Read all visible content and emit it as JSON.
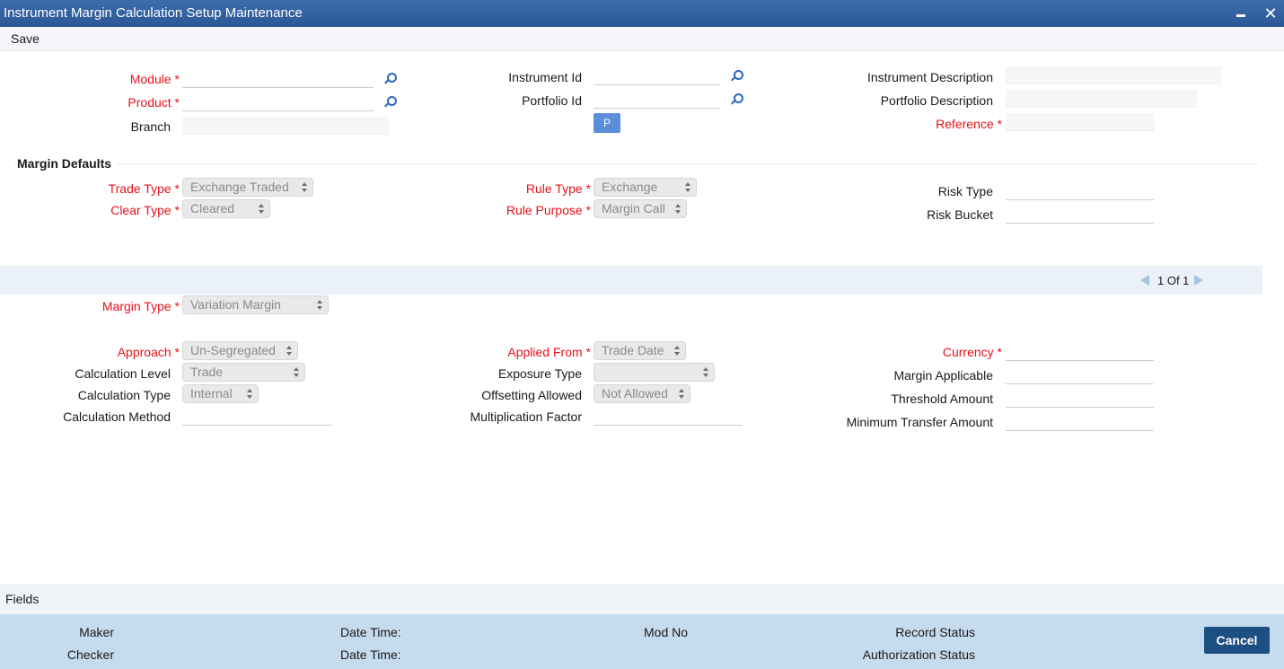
{
  "window": {
    "title": "Instrument Margin Calculation Setup Maintenance",
    "close_glyph": "✕"
  },
  "toolbar": {
    "save_label": "Save"
  },
  "header": {
    "module_label": "Module",
    "product_label": "Product",
    "branch_label": "Branch",
    "instrument_id_label": "Instrument Id",
    "portfolio_id_label": "Portfolio Id",
    "p_button_label": "P",
    "instrument_description_label": "Instrument Description",
    "portfolio_description_label": "Portfolio Description",
    "reference_label": "Reference",
    "module_value": "",
    "product_value": "",
    "branch_value": "",
    "instrument_id_value": "",
    "portfolio_id_value": "",
    "instrument_description_value": "",
    "portfolio_description_value": "",
    "reference_value": ""
  },
  "margin_defaults": {
    "section_title": "Margin Defaults",
    "trade_type": {
      "label": "Trade Type",
      "value": "Exchange Traded"
    },
    "clear_type": {
      "label": "Clear Type",
      "value": "Cleared"
    },
    "rule_type": {
      "label": "Rule Type",
      "value": "Exchange"
    },
    "rule_purpose": {
      "label": "Rule Purpose",
      "value": "Margin Call"
    },
    "risk_type": {
      "label": "Risk Type",
      "value": ""
    },
    "risk_bucket": {
      "label": "Risk Bucket",
      "value": ""
    }
  },
  "pager": {
    "text": "1 Of  1"
  },
  "margin_detail": {
    "margin_type": {
      "label": "Margin Type",
      "value": "Variation Margin"
    },
    "approach": {
      "label": "Approach",
      "value": "Un-Segregated"
    },
    "calculation_level": {
      "label": "Calculation Level",
      "value": "Trade"
    },
    "calculation_type": {
      "label": "Calculation Type",
      "value": "Internal"
    },
    "calculation_method": {
      "label": "Calculation Method",
      "value": ""
    },
    "applied_from": {
      "label": "Applied From",
      "value": "Trade Date"
    },
    "exposure_type": {
      "label": "Exposure Type",
      "value": ""
    },
    "offsetting_allowed": {
      "label": "Offsetting Allowed",
      "value": "Not Allowed"
    },
    "multiplication_factor": {
      "label": "Multiplication Factor",
      "value": ""
    },
    "currency": {
      "label": "Currency",
      "value": ""
    },
    "margin_applicable": {
      "label": "Margin Applicable",
      "value": ""
    },
    "threshold_amount": {
      "label": "Threshold Amount",
      "value": ""
    },
    "minimum_transfer_amount": {
      "label": "Minimum Transfer Amount",
      "value": ""
    }
  },
  "fields_band": {
    "label": "Fields"
  },
  "footer": {
    "maker_label": "Maker",
    "checker_label": "Checker",
    "date_time_label_1": "Date Time:",
    "date_time_label_2": "Date Time:",
    "mod_no_label": "Mod No",
    "record_status_label": "Record Status",
    "authorization_status_label": "Authorization Status",
    "cancel_label": "Cancel"
  },
  "colors": {
    "title_bar": "#2b5794",
    "required_label": "#e8101a",
    "footer_band": "#c5dcef",
    "cancel_button": "#1d4f83"
  }
}
